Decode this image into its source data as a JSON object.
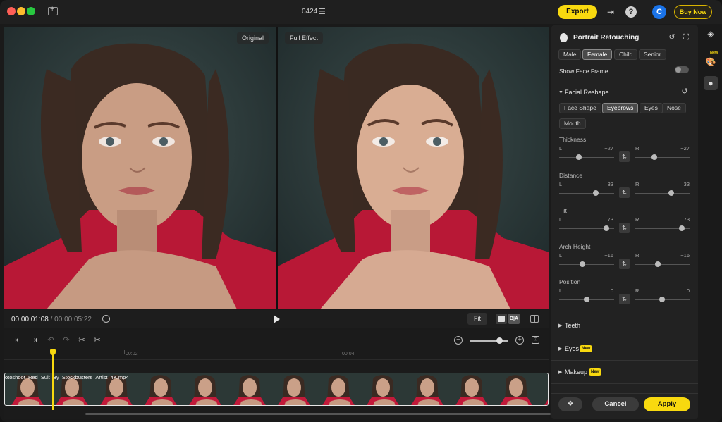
{
  "titlebar": {
    "project_name": "0424",
    "export_label": "Export",
    "help_label": "?",
    "avatar_letter": "C",
    "buy_label": "Buy Now"
  },
  "preview": {
    "original_label": "Original",
    "effect_label": "Full Effect"
  },
  "playback": {
    "current_time": "00:00:01:08",
    "duration": " / 00:00:05:22",
    "info_label": "i",
    "fit_label": "Fit",
    "compare_label": "B|A"
  },
  "timeline": {
    "ruler_ticks": [
      "00:02",
      "00:04"
    ],
    "clip_name": "otoshoot_Red_Suit_By_Stockbusters_Artist_4K.mp4",
    "zoom_minus": "−",
    "zoom_plus": "+",
    "fit_label": "⊡"
  },
  "panel": {
    "title": "Portrait Retouching",
    "genders": [
      "Male",
      "Female",
      "Child",
      "Senior"
    ],
    "selected_gender": "Female",
    "show_face_frame_label": "Show Face Frame",
    "show_face_frame_on": false,
    "facial_reshape": {
      "title": "Facial Reshape",
      "tabs": [
        "Face Shape",
        "Eyebrows",
        "Eyes",
        "Nose",
        "Mouth"
      ],
      "selected_tab": "Eyebrows",
      "sliders": [
        {
          "name": "Thickness",
          "left_label": "L",
          "left_value": "−27",
          "right_label": "R",
          "right_value": "−27",
          "left_level": -27,
          "right_level": -27
        },
        {
          "name": "Distance",
          "left_label": "L",
          "left_value": "33",
          "right_label": "R",
          "right_value": "33",
          "left_level": 33,
          "right_level": 33
        },
        {
          "name": "Tilt",
          "left_label": "L",
          "left_value": "73",
          "right_label": "R",
          "right_value": "73",
          "left_level": 73,
          "right_level": 73
        },
        {
          "name": "Arch Height",
          "left_label": "L",
          "left_value": "−16",
          "right_label": "R",
          "right_value": "−16",
          "left_level": -16,
          "right_level": -16
        },
        {
          "name": "Position",
          "left_label": "L",
          "left_value": "0",
          "right_label": "R",
          "right_value": "0",
          "left_level": 0,
          "right_level": 0
        }
      ]
    },
    "collapsed_sections": [
      {
        "title": "Teeth",
        "badge": ""
      },
      {
        "title": "Eyes",
        "badge": "New"
      },
      {
        "title": "Makeup",
        "badge": "New"
      }
    ],
    "cancel_label": "Cancel",
    "apply_label": "Apply"
  },
  "rail": {
    "new_badge": "New"
  },
  "colors": {
    "accent": "#f8d90f",
    "avatar": "#1a73e8",
    "suit_red": "#c21a3a"
  }
}
